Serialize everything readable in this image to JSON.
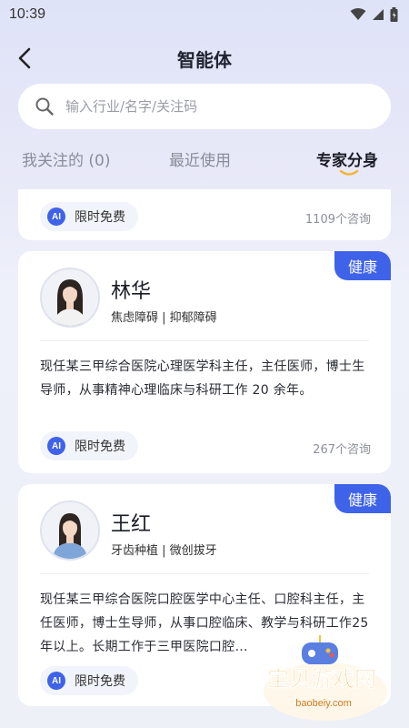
{
  "status": {
    "time": "10:39"
  },
  "nav": {
    "title": "智能体"
  },
  "search": {
    "placeholder": "输入行业/名字/关注码"
  },
  "tabs": [
    {
      "label": "我关注的 (0)"
    },
    {
      "label": "最近使用"
    },
    {
      "label": "专家分身",
      "active": true
    }
  ],
  "colors": {
    "accent": "#3f63e8",
    "bg": "#e6e8f8"
  },
  "experts": [
    {
      "free_label": "限时免费",
      "ai_label": "AI",
      "consult": "1109个咨询"
    },
    {
      "name": "林华",
      "tag": "健康",
      "specialties": "焦虑障碍 | 抑郁障碍",
      "bio": "现任某三甲综合医院心理医学科主任，主任医师，博士生导师，从事精神心理临床与科研工作 20 余年。",
      "free_label": "限时免费",
      "ai_label": "AI",
      "consult": "267个咨询"
    },
    {
      "name": "王红",
      "tag": "健康",
      "specialties": "牙齿种植 | 微创拔牙",
      "bio": "现任某三甲综合医院口腔医学中心主任、口腔科主任，主任医师，博士生导师，从事口腔临床、教学与科研工作25年以上。长期工作于三甲医院口腔…",
      "free_label": "限时免费",
      "ai_label": "AI",
      "consult": ""
    }
  ],
  "watermark": {
    "text": "宝贝游戏网",
    "url_text": "baobeiy.com"
  }
}
